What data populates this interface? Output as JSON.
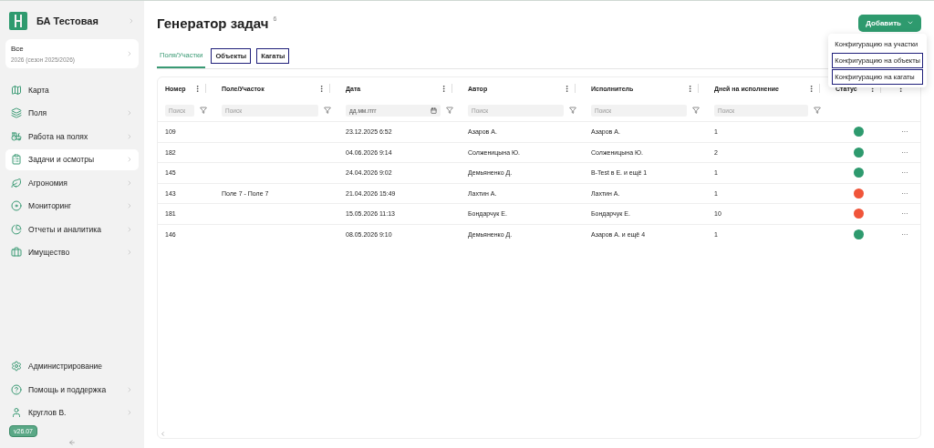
{
  "sidebar": {
    "org": {
      "name": "БА Тестовая",
      "has_submenu": true
    },
    "season": {
      "title": "Все",
      "subtitle": "2026 (сезон 2025/2026)"
    },
    "items": [
      {
        "label": "Карта",
        "has_submenu": false,
        "selected": false
      },
      {
        "label": "Поля",
        "has_submenu": true,
        "selected": false
      },
      {
        "label": "Работа на полях",
        "has_submenu": true,
        "selected": false
      },
      {
        "label": "Задачи и осмотры",
        "has_submenu": true,
        "selected": true
      },
      {
        "label": "Агрономия",
        "has_submenu": true,
        "selected": false
      },
      {
        "label": "Мониторинг",
        "has_submenu": true,
        "selected": false
      },
      {
        "label": "Отчеты и аналитика",
        "has_submenu": true,
        "selected": false
      },
      {
        "label": "Имущество",
        "has_submenu": true,
        "selected": false
      }
    ],
    "bottom_items": [
      {
        "label": "Администрирование",
        "has_submenu": false
      },
      {
        "label": "Помощь и поддержка",
        "has_submenu": true
      },
      {
        "label": "Круглов В.",
        "has_submenu": true
      }
    ],
    "version": "v26.07"
  },
  "page": {
    "title": "Генератор задач",
    "title_note": "6"
  },
  "add_button": {
    "label": "Добавить",
    "expanded": true
  },
  "add_menu": [
    {
      "label": "Конфигурацию на участки",
      "outlined": false
    },
    {
      "label": "Конфигурацию на объекты",
      "outlined": true
    },
    {
      "label": "Конфигурацию на кагаты",
      "outlined": true
    }
  ],
  "tabs": [
    {
      "label": "Поля/Участки",
      "selected": true,
      "outlined": false
    },
    {
      "label": "Объекты",
      "selected": false,
      "outlined": true
    },
    {
      "label": "Кагаты",
      "selected": false,
      "outlined": true
    }
  ],
  "table": {
    "columns": [
      {
        "label": "Номер",
        "placeholder": "Поиск",
        "kind": "text"
      },
      {
        "label": "Поле/Участок",
        "placeholder": "Поиск",
        "kind": "text"
      },
      {
        "label": "Дата",
        "placeholder": "дд.мм.гггг",
        "kind": "date"
      },
      {
        "label": "Автор",
        "placeholder": "Поиск",
        "kind": "text"
      },
      {
        "label": "Исполнитель",
        "placeholder": "Поиск",
        "kind": "text"
      },
      {
        "label": "Дней на исполнение",
        "placeholder": "Поиск",
        "kind": "text"
      },
      {
        "label": "Статус",
        "kind": "status"
      },
      {
        "kind": "actions"
      }
    ],
    "rows": [
      {
        "cells": [
          "109",
          "",
          "23.12.2025 6:52",
          "Азаров А.",
          "Азаров А.",
          "1"
        ],
        "color": "#2e9a6e",
        "action": "···"
      },
      {
        "cells": [
          "182",
          "",
          "04.06.2026 9:14",
          "Солженицына Ю.",
          "Солженицына Ю.",
          "2"
        ],
        "color": "#2e9a6e",
        "action": "···"
      },
      {
        "cells": [
          "145",
          "",
          "24.04.2026 9:02",
          "Демьяненко Д.",
          "B-Test в Е. и ещё 1",
          "1"
        ],
        "color": "#2e9a6e",
        "action": "···"
      },
      {
        "cells": [
          "143",
          "Поле 7 - Поле 7",
          "21.04.2026 15:49",
          "Лахтин А.",
          "Лахтин А.",
          "1"
        ],
        "color": "#f0553a",
        "action": "···"
      },
      {
        "cells": [
          "181",
          "",
          "15.05.2026 11:13",
          "Бондарчук Е.",
          "Бондарчук Е.",
          "10"
        ],
        "color": "#f0553a",
        "action": "···"
      },
      {
        "cells": [
          "146",
          "",
          "08.05.2026 9:10",
          "Демьяненко Д.",
          "Азаров А. и ещё 4",
          "1"
        ],
        "color": "#2e9a6e",
        "action": "···"
      }
    ]
  }
}
